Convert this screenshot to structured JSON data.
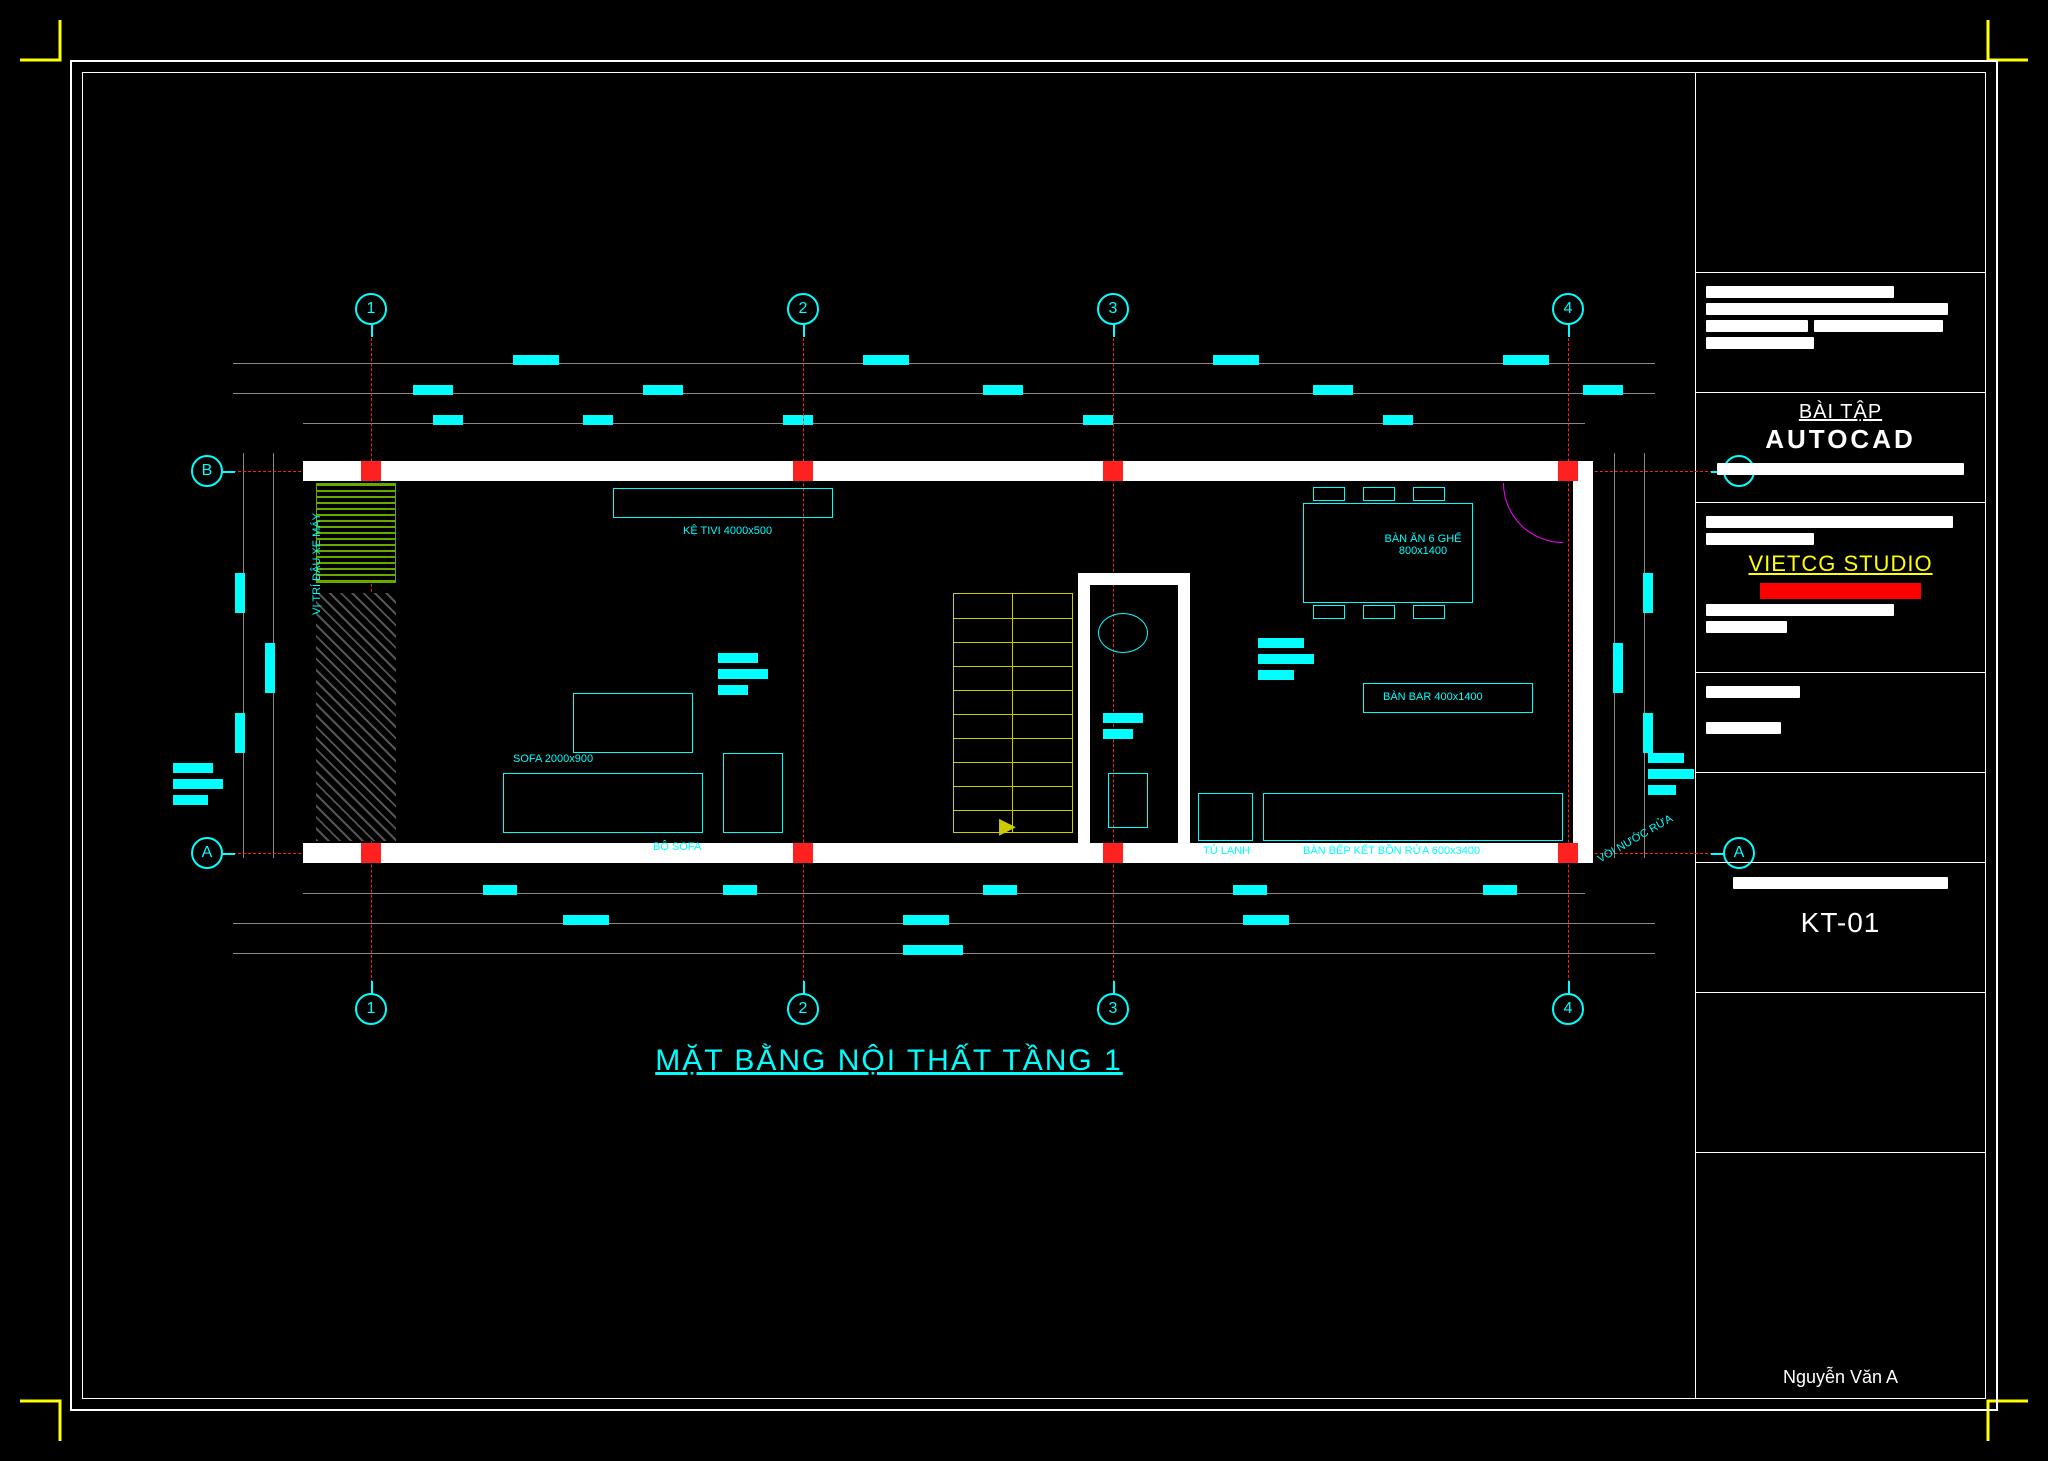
{
  "plan_title": "MẶT BẰNG NỘI THẤT TẦNG 1",
  "grid": {
    "cols": [
      "1",
      "2",
      "3",
      "4"
    ],
    "rows": [
      "A",
      "B"
    ]
  },
  "labels": {
    "tivi": "KỆ TIVI 4000x500",
    "sofa_set": "BỘ SOFA",
    "ban_an": "BÀN ĂN 6 GHẾ 800x1400",
    "ban_bar": "BÀN BAR 400x1400",
    "tu_lanh": "TỦ LẠNH",
    "bep": "BÀN BẾP KẾT BỒN RỬA 600x3400",
    "voi": "VÒI NƯỚC RỬA",
    "xe": "VỊ TRÍ ĐẬU XE MÁY"
  },
  "titleblock": {
    "section_title_1": "BÀI TẬP",
    "section_title_2": "AUTOCAD",
    "studio": "VIETCG STUDIO",
    "sheet_no": "KT-01",
    "author": "Nguyễn Văn A"
  }
}
